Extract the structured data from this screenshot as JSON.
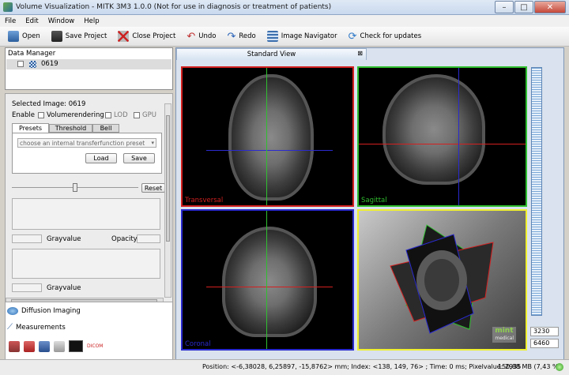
{
  "window": {
    "title": "Volume Visualization - MITK 3M3 1.0.0 (Not for use in diagnosis or treatment of patients)"
  },
  "menu": [
    "File",
    "Edit",
    "Window",
    "Help"
  ],
  "toolbar": [
    {
      "label": "Open",
      "icon": "open-icon"
    },
    {
      "label": "Save Project",
      "icon": "save-icon"
    },
    {
      "label": "Close Project",
      "icon": "close-project-icon"
    },
    {
      "label": "Undo",
      "icon": "undo-icon"
    },
    {
      "label": "Redo",
      "icon": "redo-icon"
    },
    {
      "label": "Image Navigator",
      "icon": "image-navigator-icon"
    },
    {
      "label": "Check for updates",
      "icon": "update-icon"
    }
  ],
  "data_manager": {
    "title": "Data Manager",
    "node": "0619"
  },
  "volvis": {
    "selected_image": "Selected Image: 0619",
    "enable": "Enable",
    "volumerendering": "Volumerendering",
    "lod": "LOD",
    "gpu": "GPU",
    "tabs": [
      "Presets",
      "Threshold",
      "Bell"
    ],
    "preset_placeholder": "choose an internal transferfunction preset",
    "load": "Load",
    "save": "Save",
    "reset": "Reset",
    "grayvalue": "Grayvalue",
    "opacity": "Opacity",
    "grayvalue2": "Grayvalue"
  },
  "bottom_panels": {
    "diffusion": "Diffusion Imaging",
    "measurements": "Measurements",
    "dicom": "DICOM"
  },
  "viewer": {
    "tab": "Standard View",
    "panes": {
      "transversal": "Transversal",
      "sagittal": "Sagittal",
      "coronal": "Coronal"
    },
    "logo": "mint",
    "logo_sub": "medical",
    "level_top": "3230",
    "level_bottom": "6460"
  },
  "status": {
    "text": "Position: <-6,38028, 6,25897, -15,8762> mm; Index: <138, 149, 76> ; Time: 0 ms; Pixelvalue: 2935",
    "memory": "150,88 MB (7,43 %)"
  },
  "colors": {
    "transversal": "#d42020",
    "sagittal": "#2fbf2f",
    "coronal": "#2a2ad0",
    "volume": "#f0f030"
  }
}
